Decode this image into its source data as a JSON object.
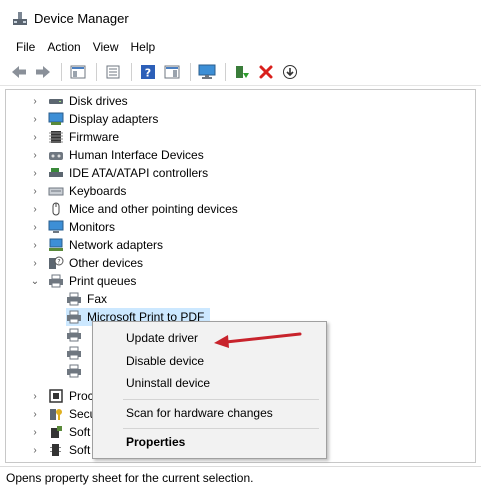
{
  "window": {
    "title": "Device Manager"
  },
  "menu": [
    "File",
    "Action",
    "View",
    "Help"
  ],
  "toolbar": {
    "icons": [
      "back-arrow-icon",
      "forward-arrow-icon",
      "show-hide-tree-icon",
      "properties-icon",
      "help-icon",
      "action-pane-icon",
      "monitor-scan-icon",
      "add-driver-icon",
      "remove-device-icon",
      "download-driver-icon"
    ],
    "accent_red": "#d9201c"
  },
  "tree": {
    "items": [
      {
        "label": "Disk drives",
        "expanded": false,
        "icon": "disk-drive-icon"
      },
      {
        "label": "Display adapters",
        "expanded": false,
        "icon": "display-adapter-icon"
      },
      {
        "label": "Firmware",
        "expanded": false,
        "icon": "firmware-icon"
      },
      {
        "label": "Human Interface Devices",
        "expanded": false,
        "icon": "hid-icon"
      },
      {
        "label": "IDE ATA/ATAPI controllers",
        "expanded": false,
        "icon": "ide-controller-icon"
      },
      {
        "label": "Keyboards",
        "expanded": false,
        "icon": "keyboard-icon"
      },
      {
        "label": "Mice and other pointing devices",
        "expanded": false,
        "icon": "mouse-icon"
      },
      {
        "label": "Monitors",
        "expanded": false,
        "icon": "monitor-icon"
      },
      {
        "label": "Network adapters",
        "expanded": false,
        "icon": "network-adapter-icon"
      },
      {
        "label": "Other devices",
        "expanded": false,
        "icon": "other-devices-icon"
      },
      {
        "label": "Print queues",
        "expanded": true,
        "icon": "printer-icon"
      }
    ],
    "print_queue_children": [
      {
        "label": "Fax",
        "selected": false
      },
      {
        "label": "Microsoft Print to PDF",
        "selected": true
      },
      {
        "label": "",
        "selected": false
      },
      {
        "label": "",
        "selected": false
      },
      {
        "label": "",
        "selected": false
      }
    ],
    "tail_items": [
      {
        "label": "Proc",
        "icon": "processor-icon"
      },
      {
        "label": "Secu",
        "icon": "security-devices-icon"
      },
      {
        "label": "Soft",
        "icon": "software-component-icon"
      },
      {
        "label": "Soft",
        "icon": "software-device-icon"
      }
    ],
    "selection_color": "#cce8ff"
  },
  "context_menu": {
    "items": [
      {
        "label": "Update driver",
        "bold": false
      },
      {
        "label": "Disable device",
        "bold": false
      },
      {
        "label": "Uninstall device",
        "bold": false
      },
      {
        "label": "Scan for hardware changes",
        "bold": false
      },
      {
        "label": "Properties",
        "bold": true
      }
    ]
  },
  "annotation": {
    "arrow_color": "#c8232c"
  },
  "status": {
    "text": "Opens property sheet for the current selection."
  }
}
